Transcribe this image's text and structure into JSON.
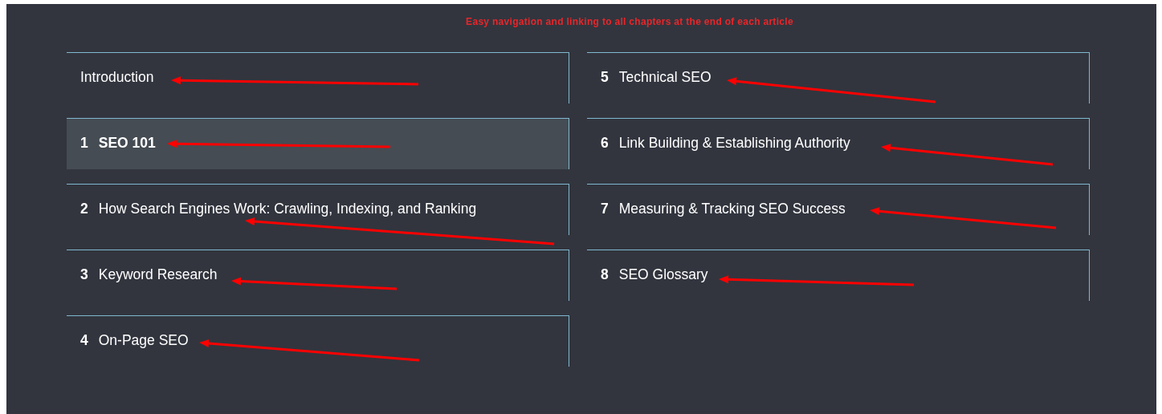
{
  "caption": "Easy navigation and linking to all chapters at the end of each article",
  "chapters": [
    {
      "title": "Introduction",
      "selected": false
    },
    {
      "number": "1",
      "title": "SEO 101",
      "selected": true
    },
    {
      "number": "2",
      "title": "How Search Engines Work: Crawling, Indexing, and Ranking",
      "selected": false
    },
    {
      "number": "3",
      "title": "Keyword Research",
      "selected": false
    },
    {
      "number": "4",
      "title": "On-Page SEO",
      "selected": false
    },
    {
      "number": "5",
      "title": "Technical SEO",
      "selected": false
    },
    {
      "number": "6",
      "title": "Link Building & Establishing Authority",
      "selected": false
    },
    {
      "number": "7",
      "title": "Measuring & Tracking SEO Success",
      "selected": false
    },
    {
      "number": "8",
      "title": "SEO Glossary",
      "selected": false
    }
  ]
}
